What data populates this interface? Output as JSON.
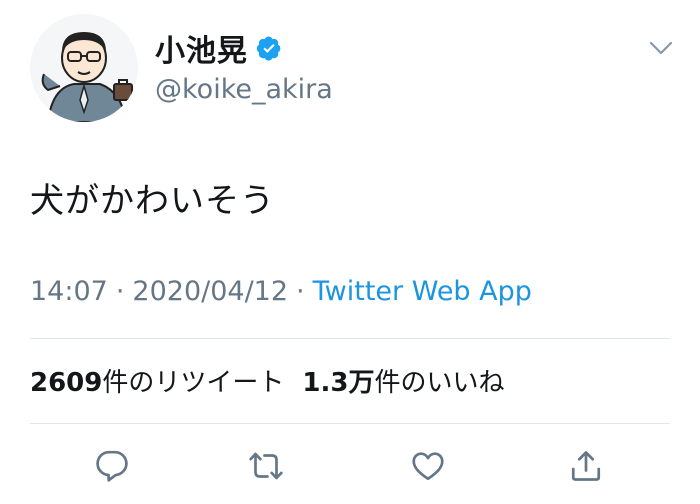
{
  "user": {
    "display_name": "小池晃",
    "handle": "@koike_akira",
    "avatar_icon": "cartoon-avatar-icon",
    "verified_icon": "verified-badge-icon"
  },
  "tweet": {
    "text": "犬がかわいそう",
    "time": "14:07",
    "date": "2020/04/12",
    "separator": "·",
    "source": "Twitter Web App"
  },
  "stats": {
    "retweets": {
      "count": "2609",
      "label": "件のリツイート"
    },
    "likes": {
      "count": "1.3万",
      "label": "件のいいね"
    }
  },
  "actions": [
    "reply-icon",
    "retweet-icon",
    "like-icon",
    "share-icon"
  ],
  "colors": {
    "link": "#1b95e0",
    "secondary_text": "#657786",
    "primary_text": "#14171a",
    "divider": "#e1e8ed",
    "verified": "#1da1f2"
  }
}
